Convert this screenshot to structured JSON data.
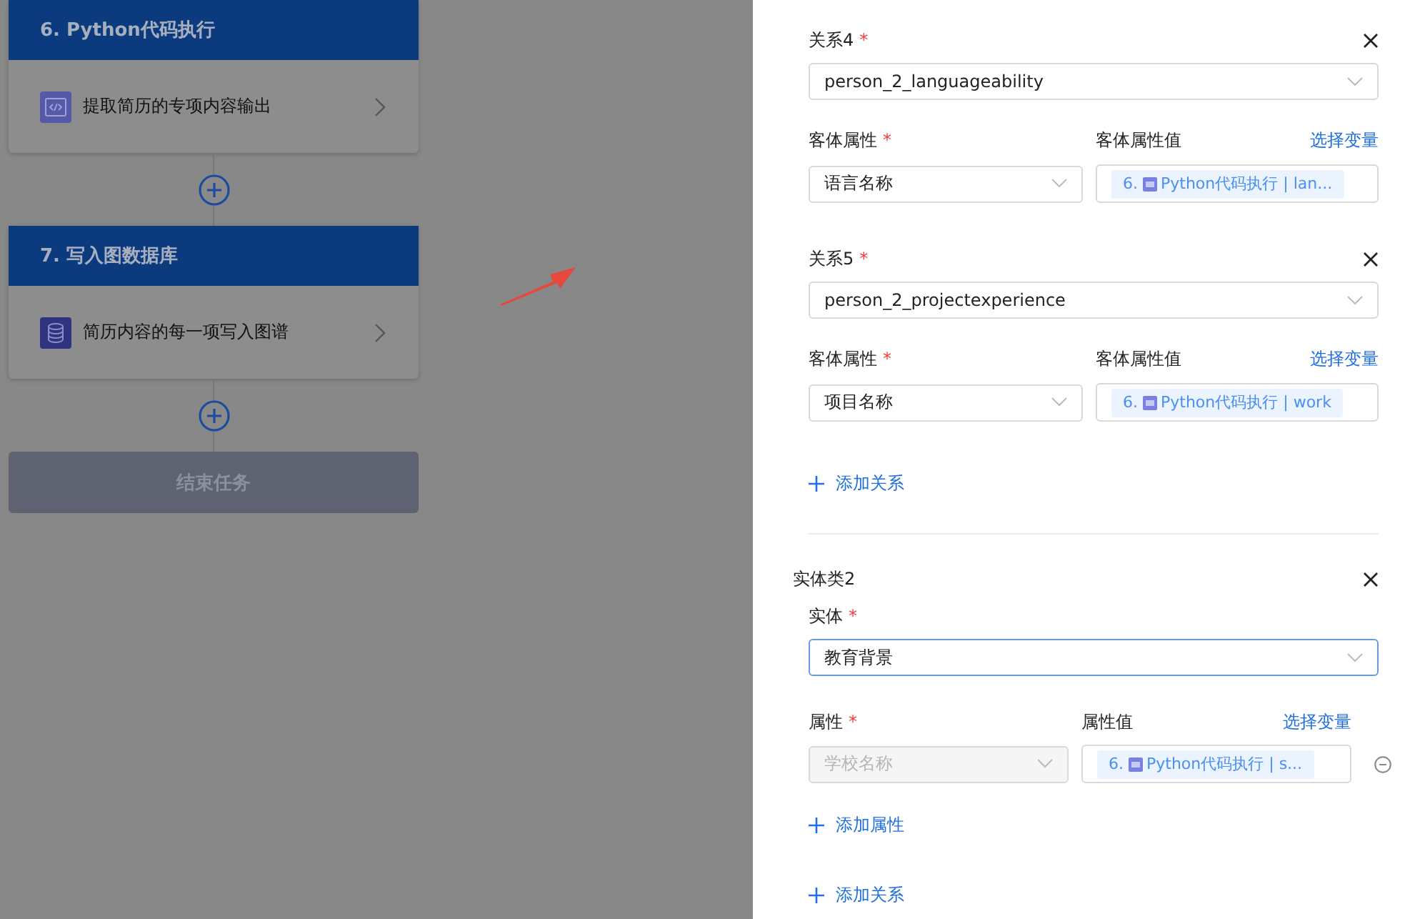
{
  "flow": {
    "nodes": [
      {
        "title": "6. Python代码执行",
        "step": "提取简历的专项内容输出",
        "kind": "code"
      },
      {
        "title": "7. 写入图数据库",
        "step": "简历内容的每一项写入图谱",
        "kind": "database"
      }
    ],
    "end_button": "结束任务"
  },
  "panel": {
    "relations": [
      {
        "label": "关系4",
        "mark": "*",
        "value": "person_2_languageability",
        "attr_label": "客体属性",
        "attr_mark": "*",
        "attr_value": "语言名称",
        "val_label": "客体属性值",
        "var_link": "选择变量",
        "tag_prefix": "6.",
        "tag_text": "Python代码执行 | lan..."
      },
      {
        "label": "关系5",
        "mark": "*",
        "value": "person_2_projectexperience",
        "attr_label": "客体属性",
        "attr_mark": "*",
        "attr_value": "项目名称",
        "val_label": "客体属性值",
        "var_link": "选择变量",
        "tag_prefix": "6.",
        "tag_text": "Python代码执行 | work"
      }
    ],
    "add_relation": "添加关系",
    "entity": {
      "title": "实体类2",
      "entity_label": "实体",
      "entity_mark": "*",
      "entity_value": "教育背景",
      "focused": true,
      "attributes": [
        {
          "label": "属性",
          "mark": "*",
          "value": "学校名称",
          "disabled": true,
          "val_label": "属性值",
          "var_link": "选择变量",
          "tag_prefix": "6.",
          "tag_text": "Python代码执行 | s..."
        }
      ],
      "add_attribute": "添加属性",
      "add_relation": "添加关系"
    }
  }
}
